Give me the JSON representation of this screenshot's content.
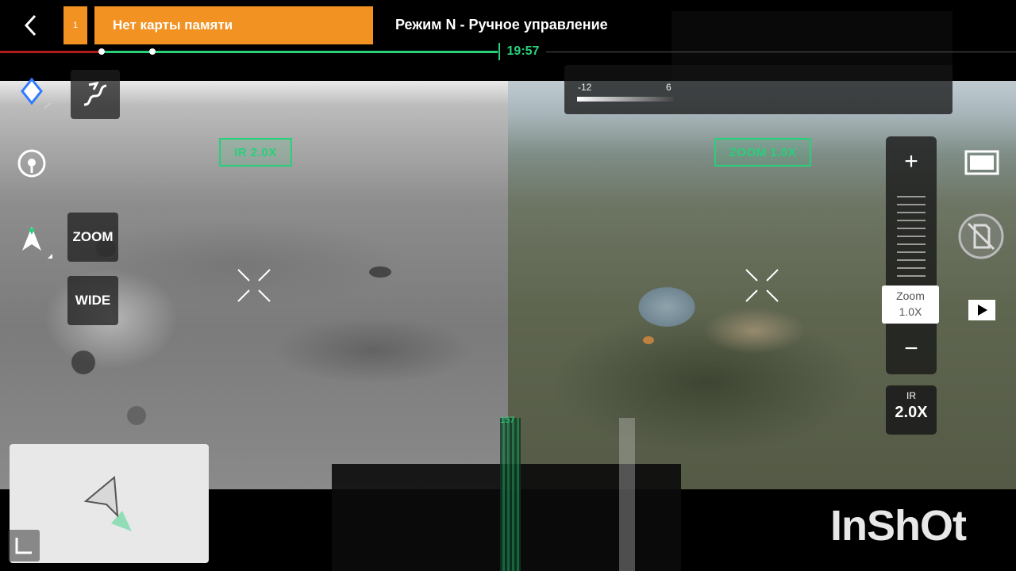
{
  "topbar": {
    "warning_small_label": "1",
    "warning_banner": "Нет карты памяти",
    "mode_title": "Режим N - Ручное управление"
  },
  "timeline": {
    "time": "19:57",
    "progress": 0.49,
    "colors": {
      "elapsed": "#2bd07a",
      "start": "#b01c1c"
    }
  },
  "ir_view": {
    "tag": "IR 2.0X"
  },
  "zoom_view": {
    "tag": "ZOOM 1.0X"
  },
  "exposure": {
    "left_label": "-12",
    "right_label": "6"
  },
  "left_tools": {
    "zoom_button": "ZOOM",
    "wide_button": "WIDE",
    "icons": [
      "diamond-location-icon",
      "path-route-icon",
      "target-icon",
      "aircraft-direction-icon"
    ]
  },
  "zoom_control": {
    "plus": "+",
    "minus": "−",
    "label_line1": "Zoom",
    "label_line2": "1.0X"
  },
  "ir_zoom": {
    "label": "IR",
    "value": "2.0X"
  },
  "right_icons": [
    "screen-frame-icon",
    "no-sd-card-icon",
    "playback-icon"
  ],
  "glitch_number": "157",
  "watermark": "InShOt",
  "accent_color": "#27d07a",
  "warning_color": "#f29222"
}
